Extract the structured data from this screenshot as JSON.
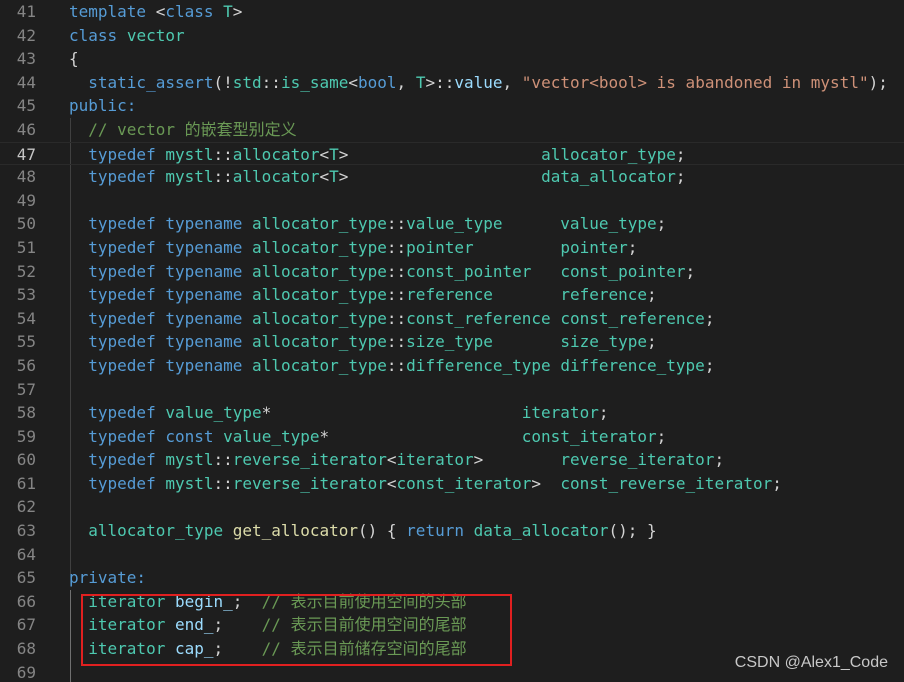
{
  "editor": {
    "watermark": "CSDN @Alex1_Code",
    "highlight_color": "#e02020",
    "lines": [
      {
        "n": "41",
        "tokens": [
          [
            "kw",
            "template"
          ],
          [
            "pl",
            " "
          ],
          [
            "pl",
            "<"
          ],
          [
            "kw",
            "class"
          ],
          [
            "pl",
            " "
          ],
          [
            "ty",
            "T"
          ],
          [
            "pl",
            ">"
          ]
        ]
      },
      {
        "n": "42",
        "tokens": [
          [
            "kw",
            "class"
          ],
          [
            "pl",
            " "
          ],
          [
            "ty",
            "vector"
          ]
        ]
      },
      {
        "n": "43",
        "tokens": [
          [
            "pl",
            "{"
          ]
        ]
      },
      {
        "n": "44",
        "tokens": [
          [
            "pl",
            "  "
          ],
          [
            "kw",
            "static_assert"
          ],
          [
            "pl",
            "(!"
          ],
          [
            "ty",
            "std"
          ],
          [
            "pl",
            "::"
          ],
          [
            "ty",
            "is_same"
          ],
          [
            "pl",
            "<"
          ],
          [
            "kw",
            "bool"
          ],
          [
            "pl",
            ", "
          ],
          [
            "ty",
            "T"
          ],
          [
            "pl",
            ">::"
          ],
          [
            "id",
            "value"
          ],
          [
            "pl",
            ", "
          ],
          [
            "str",
            "\"vector<bool> is abandoned in mystl\""
          ],
          [
            "pl",
            ");"
          ]
        ]
      },
      {
        "n": "45",
        "tokens": [
          [
            "kw",
            "public:"
          ]
        ]
      },
      {
        "n": "46",
        "tokens": [
          [
            "pl",
            "  "
          ],
          [
            "cm",
            "// vector 的嵌套型别定义"
          ]
        ]
      },
      {
        "n": "47",
        "current": true,
        "tokens": [
          [
            "pl",
            "  "
          ],
          [
            "kw",
            "typedef"
          ],
          [
            "pl",
            " "
          ],
          [
            "ty",
            "mystl"
          ],
          [
            "pl",
            "::"
          ],
          [
            "ty",
            "allocator"
          ],
          [
            "pl",
            "<"
          ],
          [
            "ty",
            "T"
          ],
          [
            "pl",
            ">                    "
          ],
          [
            "ty",
            "allocator_type"
          ],
          [
            "pl",
            ";"
          ]
        ]
      },
      {
        "n": "48",
        "tokens": [
          [
            "pl",
            "  "
          ],
          [
            "kw",
            "typedef"
          ],
          [
            "pl",
            " "
          ],
          [
            "ty",
            "mystl"
          ],
          [
            "pl",
            "::"
          ],
          [
            "ty",
            "allocator"
          ],
          [
            "pl",
            "<"
          ],
          [
            "ty",
            "T"
          ],
          [
            "pl",
            ">                    "
          ],
          [
            "ty",
            "data_allocator"
          ],
          [
            "pl",
            ";"
          ]
        ]
      },
      {
        "n": "49",
        "tokens": []
      },
      {
        "n": "50",
        "tokens": [
          [
            "pl",
            "  "
          ],
          [
            "kw",
            "typedef"
          ],
          [
            "pl",
            " "
          ],
          [
            "kw",
            "typename"
          ],
          [
            "pl",
            " "
          ],
          [
            "ty",
            "allocator_type"
          ],
          [
            "pl",
            "::"
          ],
          [
            "ty",
            "value_type"
          ],
          [
            "pl",
            "      "
          ],
          [
            "ty",
            "value_type"
          ],
          [
            "pl",
            ";"
          ]
        ]
      },
      {
        "n": "51",
        "tokens": [
          [
            "pl",
            "  "
          ],
          [
            "kw",
            "typedef"
          ],
          [
            "pl",
            " "
          ],
          [
            "kw",
            "typename"
          ],
          [
            "pl",
            " "
          ],
          [
            "ty",
            "allocator_type"
          ],
          [
            "pl",
            "::"
          ],
          [
            "ty",
            "pointer"
          ],
          [
            "pl",
            "         "
          ],
          [
            "ty",
            "pointer"
          ],
          [
            "pl",
            ";"
          ]
        ]
      },
      {
        "n": "52",
        "tokens": [
          [
            "pl",
            "  "
          ],
          [
            "kw",
            "typedef"
          ],
          [
            "pl",
            " "
          ],
          [
            "kw",
            "typename"
          ],
          [
            "pl",
            " "
          ],
          [
            "ty",
            "allocator_type"
          ],
          [
            "pl",
            "::"
          ],
          [
            "ty",
            "const_pointer"
          ],
          [
            "pl",
            "   "
          ],
          [
            "ty",
            "const_pointer"
          ],
          [
            "pl",
            ";"
          ]
        ]
      },
      {
        "n": "53",
        "tokens": [
          [
            "pl",
            "  "
          ],
          [
            "kw",
            "typedef"
          ],
          [
            "pl",
            " "
          ],
          [
            "kw",
            "typename"
          ],
          [
            "pl",
            " "
          ],
          [
            "ty",
            "allocator_type"
          ],
          [
            "pl",
            "::"
          ],
          [
            "ty",
            "reference"
          ],
          [
            "pl",
            "       "
          ],
          [
            "ty",
            "reference"
          ],
          [
            "pl",
            ";"
          ]
        ]
      },
      {
        "n": "54",
        "tokens": [
          [
            "pl",
            "  "
          ],
          [
            "kw",
            "typedef"
          ],
          [
            "pl",
            " "
          ],
          [
            "kw",
            "typename"
          ],
          [
            "pl",
            " "
          ],
          [
            "ty",
            "allocator_type"
          ],
          [
            "pl",
            "::"
          ],
          [
            "ty",
            "const_reference"
          ],
          [
            "pl",
            " "
          ],
          [
            "ty",
            "const_reference"
          ],
          [
            "pl",
            ";"
          ]
        ]
      },
      {
        "n": "55",
        "tokens": [
          [
            "pl",
            "  "
          ],
          [
            "kw",
            "typedef"
          ],
          [
            "pl",
            " "
          ],
          [
            "kw",
            "typename"
          ],
          [
            "pl",
            " "
          ],
          [
            "ty",
            "allocator_type"
          ],
          [
            "pl",
            "::"
          ],
          [
            "ty",
            "size_type"
          ],
          [
            "pl",
            "       "
          ],
          [
            "ty",
            "size_type"
          ],
          [
            "pl",
            ";"
          ]
        ]
      },
      {
        "n": "56",
        "tokens": [
          [
            "pl",
            "  "
          ],
          [
            "kw",
            "typedef"
          ],
          [
            "pl",
            " "
          ],
          [
            "kw",
            "typename"
          ],
          [
            "pl",
            " "
          ],
          [
            "ty",
            "allocator_type"
          ],
          [
            "pl",
            "::"
          ],
          [
            "ty",
            "difference_type"
          ],
          [
            "pl",
            " "
          ],
          [
            "ty",
            "difference_type"
          ],
          [
            "pl",
            ";"
          ]
        ]
      },
      {
        "n": "57",
        "tokens": []
      },
      {
        "n": "58",
        "tokens": [
          [
            "pl",
            "  "
          ],
          [
            "kw",
            "typedef"
          ],
          [
            "pl",
            " "
          ],
          [
            "ty",
            "value_type"
          ],
          [
            "pl",
            "*                          "
          ],
          [
            "ty",
            "iterator"
          ],
          [
            "pl",
            ";"
          ]
        ]
      },
      {
        "n": "59",
        "tokens": [
          [
            "pl",
            "  "
          ],
          [
            "kw",
            "typedef"
          ],
          [
            "pl",
            " "
          ],
          [
            "kw",
            "const"
          ],
          [
            "pl",
            " "
          ],
          [
            "ty",
            "value_type"
          ],
          [
            "pl",
            "*                    "
          ],
          [
            "ty",
            "const_iterator"
          ],
          [
            "pl",
            ";"
          ]
        ]
      },
      {
        "n": "60",
        "tokens": [
          [
            "pl",
            "  "
          ],
          [
            "kw",
            "typedef"
          ],
          [
            "pl",
            " "
          ],
          [
            "ty",
            "mystl"
          ],
          [
            "pl",
            "::"
          ],
          [
            "ty",
            "reverse_iterator"
          ],
          [
            "pl",
            "<"
          ],
          [
            "ty",
            "iterator"
          ],
          [
            "pl",
            ">        "
          ],
          [
            "ty",
            "reverse_iterator"
          ],
          [
            "pl",
            ";"
          ]
        ]
      },
      {
        "n": "61",
        "tokens": [
          [
            "pl",
            "  "
          ],
          [
            "kw",
            "typedef"
          ],
          [
            "pl",
            " "
          ],
          [
            "ty",
            "mystl"
          ],
          [
            "pl",
            "::"
          ],
          [
            "ty",
            "reverse_iterator"
          ],
          [
            "pl",
            "<"
          ],
          [
            "ty",
            "const_iterator"
          ],
          [
            "pl",
            ">  "
          ],
          [
            "ty",
            "const_reverse_iterator"
          ],
          [
            "pl",
            ";"
          ]
        ]
      },
      {
        "n": "62",
        "tokens": []
      },
      {
        "n": "63",
        "tokens": [
          [
            "pl",
            "  "
          ],
          [
            "ty",
            "allocator_type"
          ],
          [
            "pl",
            " "
          ],
          [
            "fn",
            "get_allocator"
          ],
          [
            "pl",
            "() { "
          ],
          [
            "kw",
            "return"
          ],
          [
            "pl",
            " "
          ],
          [
            "ty",
            "data_allocator"
          ],
          [
            "pl",
            "(); }"
          ]
        ]
      },
      {
        "n": "64",
        "tokens": []
      },
      {
        "n": "65",
        "tokens": [
          [
            "kw",
            "private:"
          ]
        ]
      },
      {
        "n": "66",
        "tokens": [
          [
            "pl",
            "  "
          ],
          [
            "ty",
            "iterator"
          ],
          [
            "pl",
            " "
          ],
          [
            "id",
            "begin_"
          ],
          [
            "pl",
            ";  "
          ],
          [
            "cm",
            "// 表示目前使用空间的头部"
          ]
        ]
      },
      {
        "n": "67",
        "tokens": [
          [
            "pl",
            "  "
          ],
          [
            "ty",
            "iterator"
          ],
          [
            "pl",
            " "
          ],
          [
            "id",
            "end_"
          ],
          [
            "pl",
            ";    "
          ],
          [
            "cm",
            "// 表示目前使用空间的尾部"
          ]
        ]
      },
      {
        "n": "68",
        "tokens": [
          [
            "pl",
            "  "
          ],
          [
            "ty",
            "iterator"
          ],
          [
            "pl",
            " "
          ],
          [
            "id",
            "cap_"
          ],
          [
            "pl",
            ";    "
          ],
          [
            "cm",
            "// 表示目前储存空间的尾部"
          ]
        ]
      },
      {
        "n": "69",
        "tokens": []
      }
    ]
  }
}
